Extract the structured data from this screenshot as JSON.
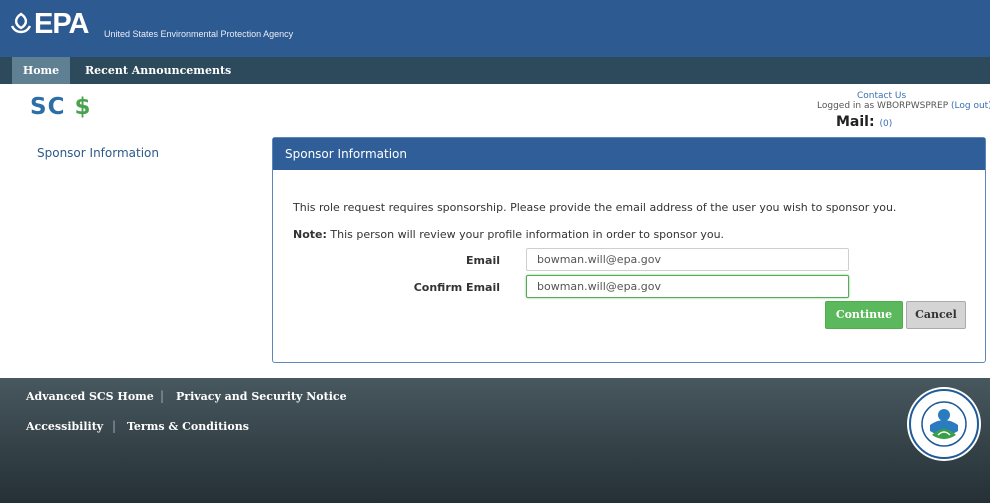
{
  "header": {
    "logo_text": "EPA",
    "agency_name": "United States Environmental Protection Agency"
  },
  "nav": {
    "tabs": [
      {
        "label": "Home",
        "active": true
      },
      {
        "label": "Recent Announcements",
        "active": false
      }
    ]
  },
  "app": {
    "logo_text": "SCS",
    "logo_dollar": "$"
  },
  "user": {
    "contact_label": "Contact Us",
    "logged_in_prefix": "Logged in as",
    "username": "WBORPWSPREP",
    "logout_label": "(Log out)",
    "mail_label": "Mail:",
    "mail_count": "(0)"
  },
  "sidebar": {
    "items": [
      {
        "label": "Sponsor Information"
      }
    ]
  },
  "panel": {
    "title": "Sponsor Information",
    "intro": "This role request requires sponsorship. Please provide the email address of the user you wish to sponsor you.",
    "note_label": "Note:",
    "note_text": "This person will review your profile information in order to sponsor you.",
    "email_label": "Email",
    "email_value": "bowman.will@epa.gov",
    "confirm_label": "Confirm Email",
    "confirm_value": "bowman.will@epa.gov",
    "continue_label": "Continue",
    "cancel_label": "Cancel"
  },
  "footer": {
    "links": [
      {
        "label": "Advanced SCS Home"
      },
      {
        "label": "Privacy and Security Notice"
      },
      {
        "label": "Accessibility"
      },
      {
        "label": "Terms & Conditions"
      }
    ],
    "seal_text": "UNITED STATES · ENVIRONMENTAL PROTECTION AGENCY"
  },
  "colors": {
    "header_bg": "#2e5a92",
    "nav_bg": "#2d4a5c",
    "panel_head": "#2f5e98",
    "continue_green": "#5cb85c",
    "footer_bg": "#3a484e"
  }
}
